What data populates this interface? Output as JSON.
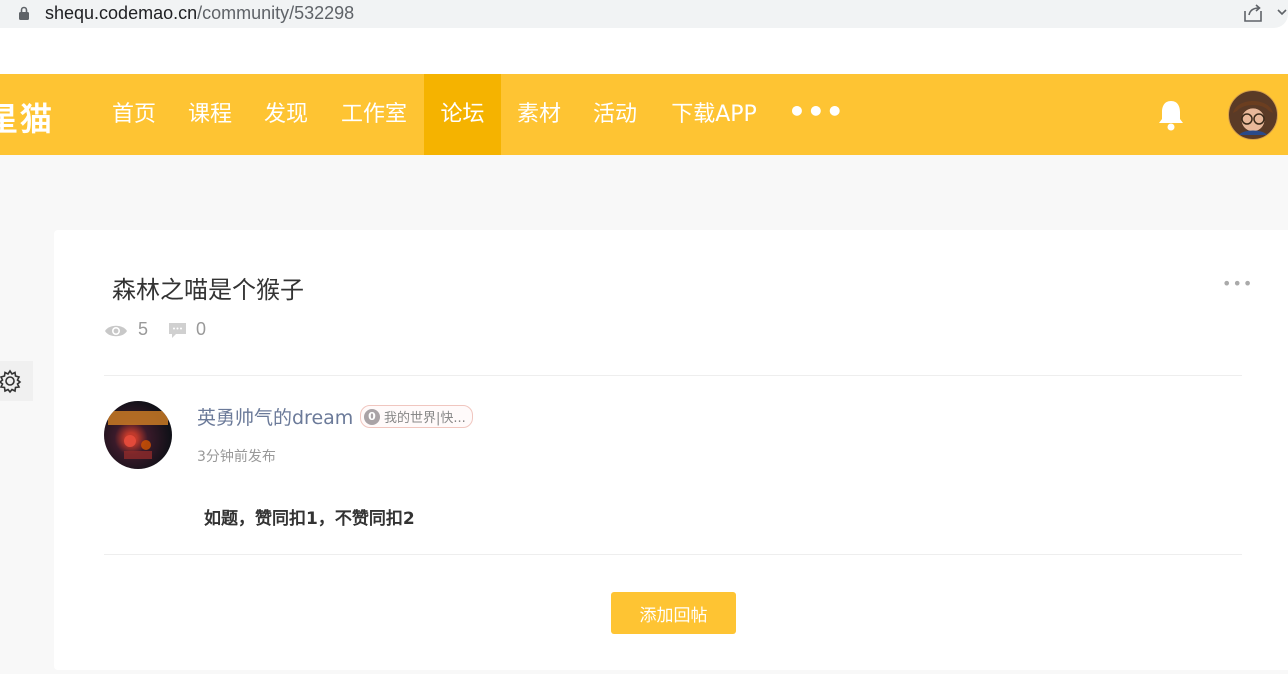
{
  "browser": {
    "url_host": "shequ.codemao.cn",
    "url_path": "/community/532298"
  },
  "nav": {
    "logo": "星猫",
    "items": [
      {
        "label": "首页"
      },
      {
        "label": "课程"
      },
      {
        "label": "发现"
      },
      {
        "label": "工作室"
      },
      {
        "label": "论坛",
        "active": true
      },
      {
        "label": "素材"
      },
      {
        "label": "活动"
      },
      {
        "label": "下载APP"
      }
    ],
    "more": "•••"
  },
  "post": {
    "title": "森林之喵是个猴子",
    "more": "•••",
    "views": "5",
    "comments": "0",
    "author": {
      "name": "英勇帅气的dream",
      "badge_level": "0",
      "badge_text": "我的世界|快..."
    },
    "time": "3分钟前发布",
    "body": "如题，赞同扣1，不赞同扣2",
    "reply_button": "添加回帖"
  },
  "colors": {
    "brand": "#fec433",
    "brand_active": "#f5b300",
    "author_name": "#6b7a99"
  }
}
